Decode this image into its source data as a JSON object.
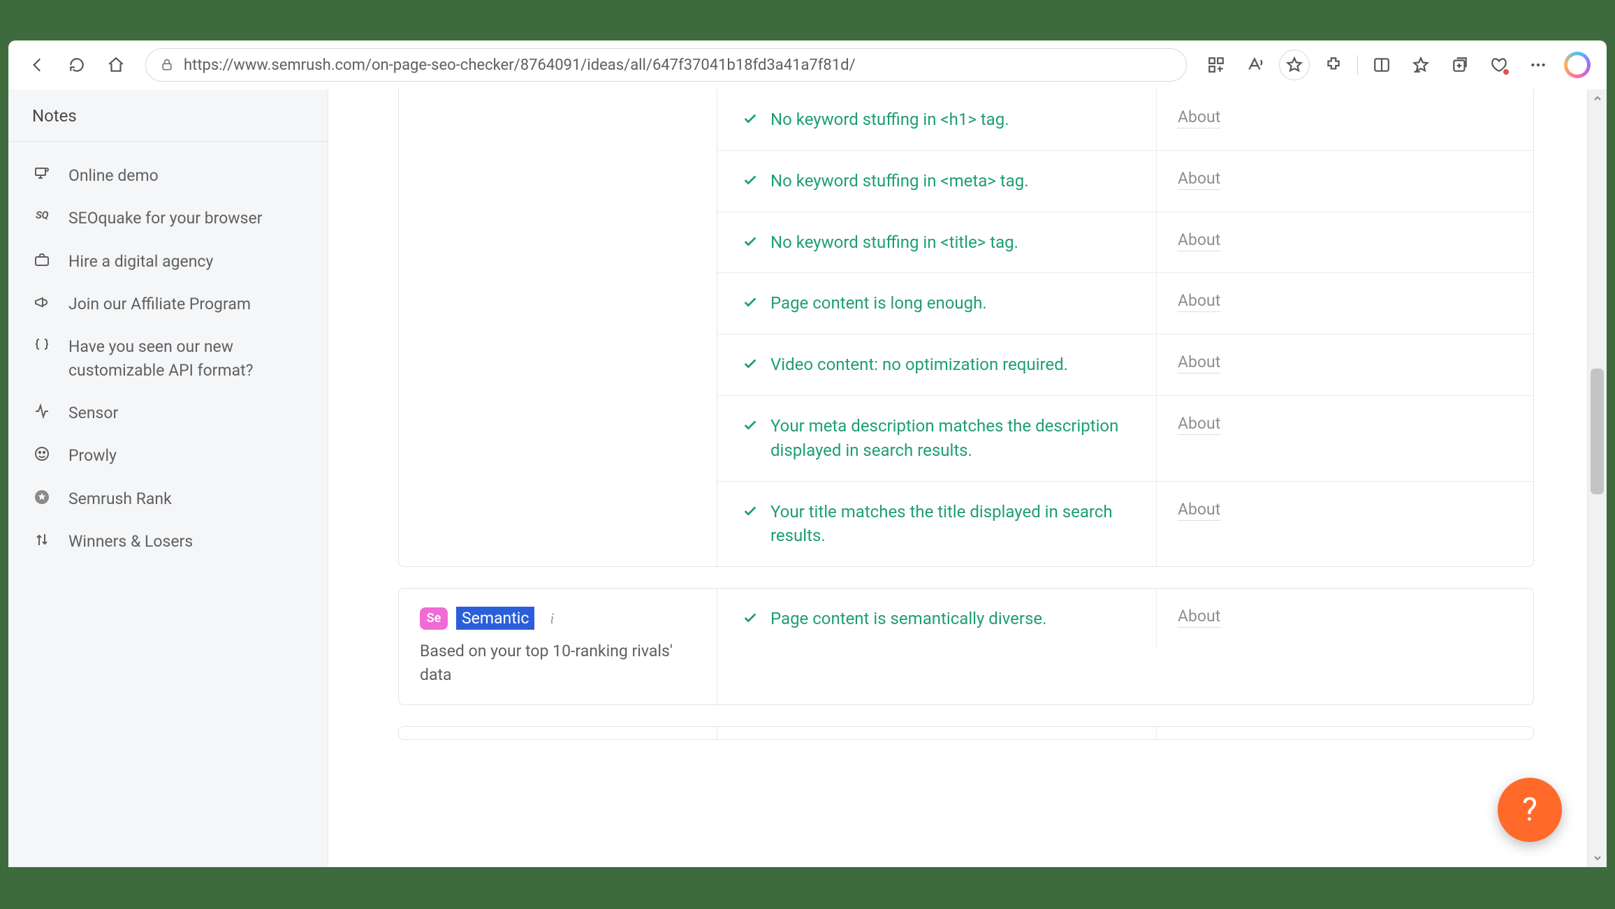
{
  "browser": {
    "url": "https://www.semrush.com/on-page-seo-checker/8764091/ideas/all/647f37041b18fd3a41a7f81d/"
  },
  "sidebar": {
    "header": "Notes",
    "items": [
      {
        "label": "Online demo"
      },
      {
        "label": "SEOquake for your browser"
      },
      {
        "label": "Hire a digital agency"
      },
      {
        "label": "Join our Affiliate Program"
      },
      {
        "label": "Have you seen our new customizable API format?"
      },
      {
        "label": "Sensor"
      },
      {
        "label": "Prowly"
      },
      {
        "label": "Semrush Rank"
      },
      {
        "label": "Winners & Losers"
      }
    ]
  },
  "about_label": "About",
  "main": {
    "rows": [
      {
        "text": "No keyword stuffing in <h1> tag."
      },
      {
        "text": "No keyword stuffing in <meta> tag."
      },
      {
        "text": "No keyword stuffing in <title> tag."
      },
      {
        "text": "Page content is long enough."
      },
      {
        "text": "Video content: no optimization required."
      },
      {
        "text": "Your meta description matches the description displayed in search results."
      },
      {
        "text": "Your title matches the title displayed in search results."
      }
    ],
    "semantic": {
      "badge": "Se",
      "label": "Semantic",
      "subtitle": "Based on your top 10-ranking rivals' data",
      "row_text": "Page content is semantically diverse."
    }
  },
  "help": "?"
}
